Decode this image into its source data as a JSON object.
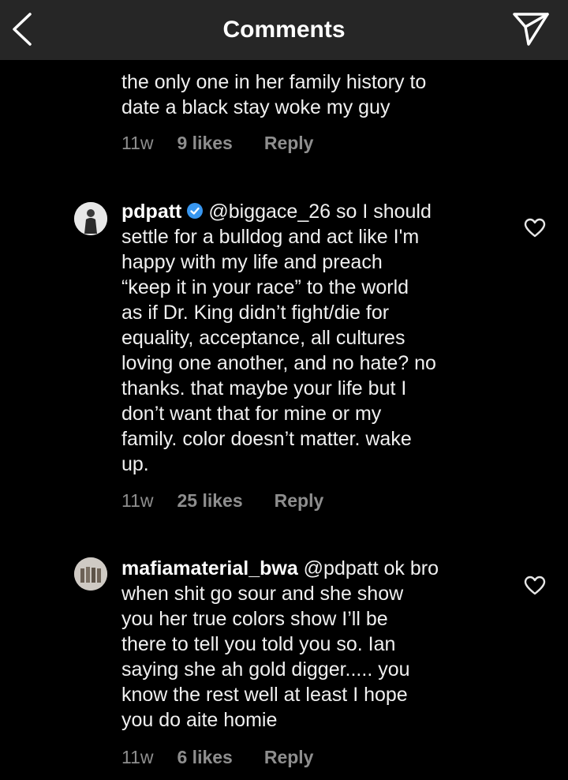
{
  "header": {
    "title": "Comments",
    "back_icon": "chevron-left-icon",
    "send_icon": "paper-plane-icon"
  },
  "comments": [
    {
      "username": "",
      "text": "the only one in her family history to\ndate a black stay woke my guy",
      "time": "11w",
      "likes": "9 likes",
      "reply": "Reply"
    },
    {
      "username": "pdpatt",
      "verified": true,
      "text": "@biggace_26 so I should\nsettle for a bulldog and act like I'm\nhappy with my life and preach\n“keep it in your race” to the world\nas if Dr. King didn’t fight/die for\nequality, acceptance, all cultures\nloving one another, and no hate? no\nthanks. that maybe your life but I\ndon’t want that for mine or my\nfamily. color doesn’t matter. wake\nup.",
      "time": "11w",
      "likes": "25 likes",
      "reply": "Reply"
    },
    {
      "username": "mafiamaterial_bwa",
      "verified": false,
      "text": "@pdpatt ok bro\nwhen shit go sour and she show\nyou her true colors show I’ll be\nthere to tell you told you so. Ian\nsaying she ah gold digger..... you\nknow the rest well at least I hope\nyou do aite homie",
      "time": "11w",
      "likes": "6 likes",
      "reply": "Reply"
    }
  ],
  "colors": {
    "background": "#000000",
    "header": "#262626",
    "text": "#f0f0f0",
    "meta": "#8e8e8e",
    "verified": "#3897f0"
  }
}
